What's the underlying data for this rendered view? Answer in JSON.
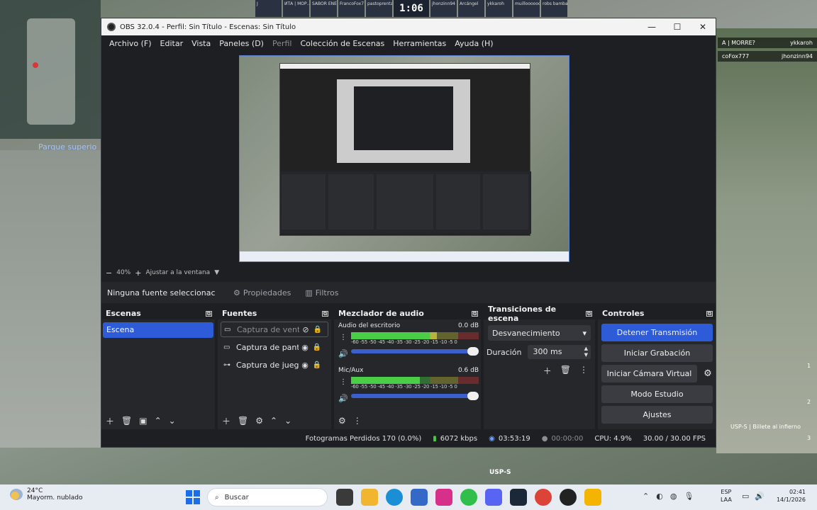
{
  "game": {
    "location": "Parque superio",
    "round_time": "1:06",
    "score_players_left": [
      "J",
      "ИТА | МОР...",
      "SABOR ENE...",
      "FrancoFox77",
      "pastoprenta"
    ],
    "score_players_right": [
      "jhonzinn94",
      "Arcángel",
      "ykkaroh",
      "muilloooooo...",
      "robs bambas"
    ],
    "killfeed": [
      {
        "killer": "A | MORRE?",
        "victim": "ykkaroh"
      },
      {
        "killer": "coFox777",
        "victim": "jhonzinn94"
      }
    ],
    "weapon_label": "USP-S | Billete al infierno",
    "center_label": "USP-S",
    "slot_numbers": [
      "1",
      "2",
      "3"
    ]
  },
  "obs": {
    "title": "OBS 32.0.4 - Perfil: Sin Título - Escenas: Sin Título",
    "window_buttons": {
      "minimize": "—",
      "maximize": "☐",
      "close": "✕"
    },
    "menu": [
      {
        "label": "Archivo (F)",
        "enabled": true
      },
      {
        "label": "Editar",
        "enabled": true
      },
      {
        "label": "Vista",
        "enabled": true
      },
      {
        "label": "Paneles (D)",
        "enabled": true
      },
      {
        "label": "Perfil",
        "enabled": false
      },
      {
        "label": "Colección de Escenas",
        "enabled": true
      },
      {
        "label": "Herramientas",
        "enabled": true
      },
      {
        "label": "Ayuda (H)",
        "enabled": true
      }
    ],
    "zoom": {
      "minus": "−",
      "value": "40%",
      "plus": "+",
      "fit": "Ajustar a la ventana",
      "dropdown": "▼"
    },
    "source_toolbar": {
      "no_selection": "Ninguna fuente seleccionac",
      "properties": "Propiedades",
      "filters": "Filtros"
    },
    "docks": {
      "scenes": {
        "title": "Escenas",
        "items": [
          "Escena"
        ]
      },
      "sources": {
        "title": "Fuentes",
        "items": [
          {
            "label": "Captura de ventar",
            "icon": "▭",
            "visible": false,
            "locked": true
          },
          {
            "label": "Captura de pantal",
            "icon": "▭",
            "visible": true,
            "locked": true
          },
          {
            "label": "Captura de juego",
            "icon": "⊶",
            "visible": true,
            "locked": true
          }
        ]
      },
      "mixer": {
        "title": "Mezclador de audio",
        "channels": [
          {
            "name": "Audio del escritorio",
            "db": "0.0 dB",
            "level": 0.67
          },
          {
            "name": "Mic/Aux",
            "db": "0.6 dB",
            "level": 0.54
          }
        ],
        "scale": "-60 -55 -50 -45 -40 -35 -30 -25 -20 -15 -10  -5   0"
      },
      "transitions": {
        "title": "Transiciones de escena",
        "selected": "Desvanecimiento",
        "duration_label": "Duración",
        "duration_value": "300 ms"
      },
      "controls": {
        "title": "Controles",
        "buttons": [
          "Detener Transmisión",
          "Iniciar Grabación",
          "Iniciar Cámara Virtual",
          "Modo Estudio",
          "Ajustes"
        ]
      }
    },
    "status": {
      "dropped_frames": "Fotogramas Perdidos 170 (0.0%)",
      "bitrate": "6072 kbps",
      "stream_time": "03:53:19",
      "record_time": "00:00:00",
      "cpu": "CPU: 4.9%",
      "fps": "30.00 / 30.00 FPS"
    },
    "colors": {
      "accent": "#2e5bd8",
      "bg": "#1e1f22",
      "panel": "#26272b"
    }
  },
  "taskbar": {
    "temperature": "24°C",
    "weather": "Mayorm. nublado",
    "search_placeholder": "Buscar",
    "lang_1": "ESP",
    "lang_2": "LAA",
    "time": "02:41",
    "date": "14/1/2026"
  }
}
